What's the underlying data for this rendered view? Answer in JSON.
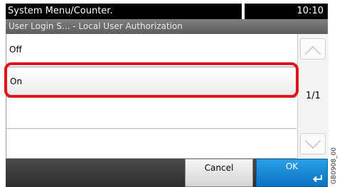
{
  "header": {
    "title": "System Menu/Counter.",
    "time": "10:10"
  },
  "subheader": {
    "title": "User Login S... - Local User Authorization"
  },
  "options": [
    {
      "label": "Off",
      "selected": false
    },
    {
      "label": "On",
      "selected": true
    }
  ],
  "pager": {
    "text": "1/1"
  },
  "footer": {
    "cancel_label": "Cancel",
    "ok_label": "OK"
  },
  "figure_code": "GB0908_00",
  "colors": {
    "ok_button": "#1d8fdc",
    "highlight": "#e0141d"
  }
}
